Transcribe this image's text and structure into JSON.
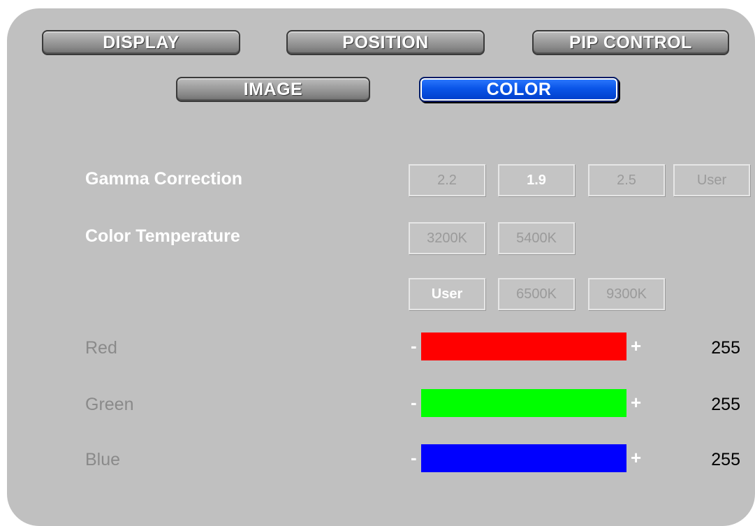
{
  "tabs": {
    "display": "DISPLAY",
    "position": "POSITION",
    "pip_control": "PIP CONTROL",
    "image": "IMAGE",
    "color": "COLOR",
    "active": "COLOR"
  },
  "gamma": {
    "label": "Gamma Correction",
    "options": [
      "2.2",
      "1.9",
      "2.5",
      "User"
    ],
    "selected": "1.9"
  },
  "color_temperature": {
    "label": "Color Temperature",
    "row1": [
      "3200K",
      "5400K"
    ],
    "row2": [
      "User",
      "6500K",
      "9300K"
    ],
    "selected": "User"
  },
  "rgb": {
    "red": {
      "label": "Red",
      "value": "255",
      "color": "#ff0000"
    },
    "green": {
      "label": "Green",
      "value": "255",
      "color": "#00ff00"
    },
    "blue": {
      "label": "Blue",
      "value": "255",
      "color": "#0000ff"
    },
    "minus_symbol": "-",
    "plus_symbol": "+"
  }
}
